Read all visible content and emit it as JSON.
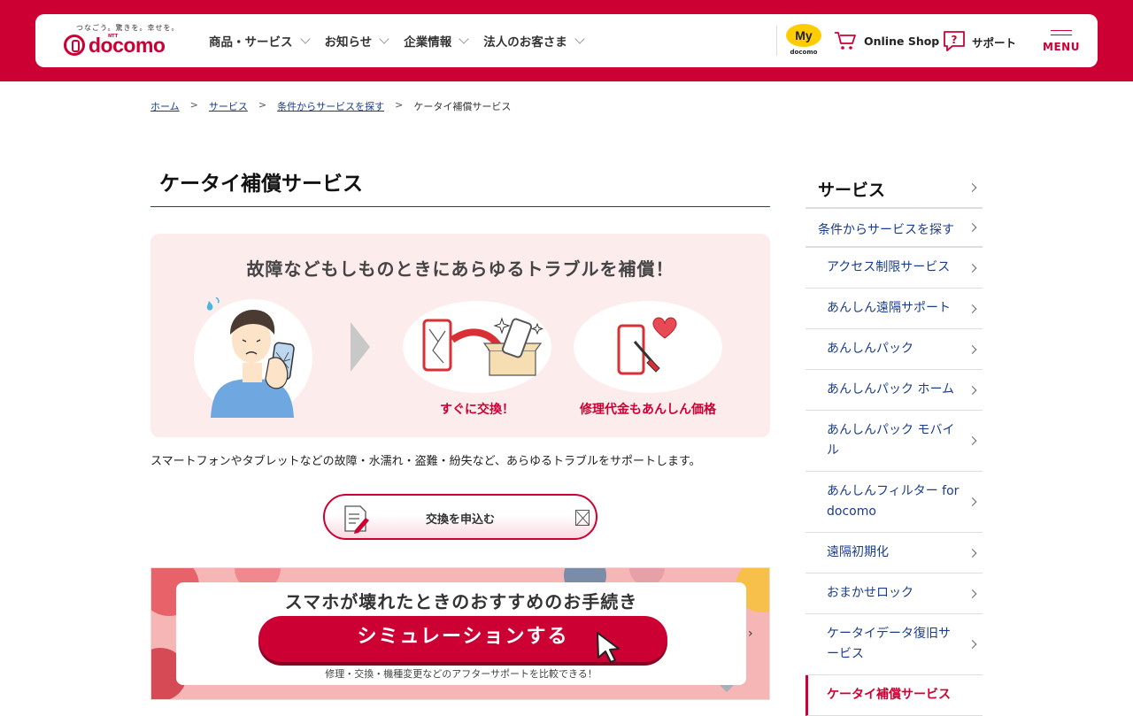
{
  "header": {
    "logo_tagline": "つなごう。驚きを。幸せを。",
    "logo_ntt": "NTT",
    "logo_text": "docomo",
    "nav": [
      "商品・サービス",
      "お知らせ",
      "企業情報",
      "法人のお客さま"
    ],
    "my_label": "My",
    "my_sub": "docomo",
    "online_shop": "Online Shop",
    "support": "サポート",
    "menu": "MENU",
    "brand_color": "#cc0033"
  },
  "breadcrumb": [
    "ホーム",
    "サービス",
    "条件からサービスを探す",
    "ケータイ補償サービス"
  ],
  "breadcrumb_sep": ">",
  "page_title": "ケータイ補償サービス",
  "hero": {
    "title": "故障などもしものときにあらゆるトラブルを補償！",
    "caption1": "すぐに交換！",
    "caption2": "修理代金もあんしん価格"
  },
  "description": "スマートフォンやタブレットなどの故障・水濡れ・盗難・紛失など、あらゆるトラブルをサポートします。",
  "apply_button": "交換を申込む",
  "banner": {
    "title": "スマホが壊れたときのおすすめのお手続き",
    "button": "シミュレーションする",
    "sub": "修理・交換・機種変更などのアフターサポートを比較できる！",
    "next": "›"
  },
  "sidebar": {
    "head": "サービス",
    "level1": "条件からサービスを探す",
    "items": [
      "アクセス制限サービス",
      "あんしん遠隔サポート",
      "あんしんパック",
      "あんしんパック ホーム",
      "あんしんパック モバイル",
      "あんしんフィルター for docomo",
      "遠隔初期化",
      "おまかせロック",
      "ケータイデータ復旧サービス",
      "ケータイ補償サービス"
    ]
  }
}
